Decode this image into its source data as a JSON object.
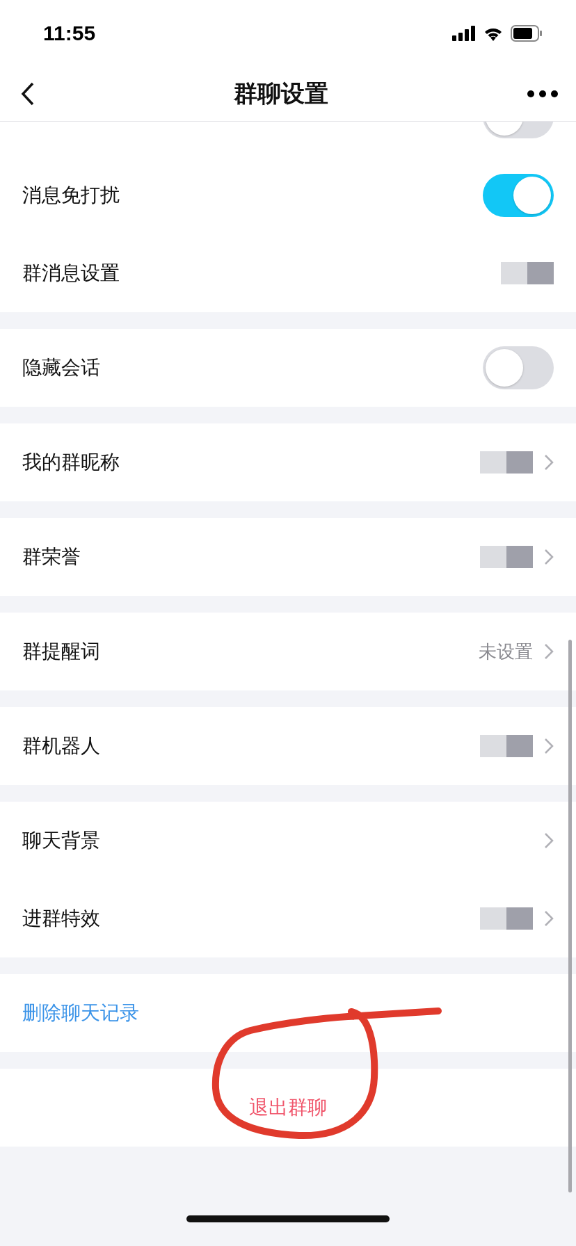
{
  "status_bar": {
    "time": "11:55"
  },
  "nav": {
    "title": "群聊设置"
  },
  "clipped_row": {
    "on": false
  },
  "sections": [
    {
      "rows": [
        {
          "kind": "toggle",
          "label": "消息免打扰",
          "on": true
        },
        {
          "kind": "value",
          "label": "群消息设置",
          "redacted": true,
          "chevron": false
        }
      ]
    },
    {
      "rows": [
        {
          "kind": "toggle",
          "label": "隐藏会话",
          "on": false
        }
      ]
    },
    {
      "rows": [
        {
          "kind": "value",
          "label": "我的群昵称",
          "redacted": true,
          "chevron": true
        }
      ]
    },
    {
      "rows": [
        {
          "kind": "value",
          "label": "群荣誉",
          "redacted": true,
          "chevron": true
        }
      ]
    },
    {
      "rows": [
        {
          "kind": "value",
          "label": "群提醒词",
          "value": "未设置",
          "redacted": false,
          "chevron": true
        }
      ]
    },
    {
      "rows": [
        {
          "kind": "value",
          "label": "群机器人",
          "redacted": true,
          "chevron": true
        }
      ]
    },
    {
      "rows": [
        {
          "kind": "value",
          "label": "聊天背景",
          "redacted": false,
          "chevron": true
        },
        {
          "kind": "value",
          "label": "进群特效",
          "redacted": true,
          "chevron": true
        }
      ]
    },
    {
      "rows": [
        {
          "kind": "link",
          "label": "删除聊天记录"
        }
      ]
    },
    {
      "rows": [
        {
          "kind": "danger",
          "label": "退出群聊"
        }
      ]
    }
  ]
}
